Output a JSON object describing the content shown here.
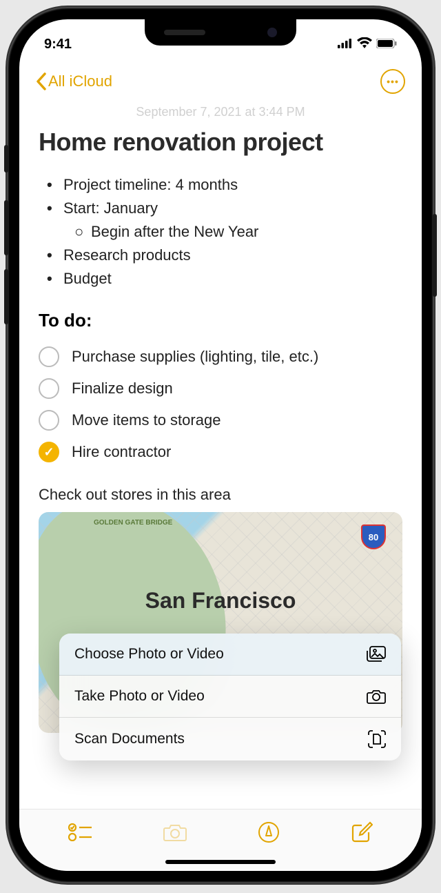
{
  "statusbar": {
    "time": "9:41"
  },
  "nav": {
    "back_label": "All iCloud"
  },
  "note": {
    "date": "September 7, 2021 at 3:44 PM",
    "title": "Home renovation project",
    "bullets": [
      "Project timeline: 4 months",
      "Start: January",
      "Research products",
      "Budget"
    ],
    "sub_bullet": "Begin after the New Year",
    "todo_heading": "To do:",
    "todos": [
      {
        "label": "Purchase supplies (lighting, tile, etc.)",
        "done": false
      },
      {
        "label": "Finalize design",
        "done": false
      },
      {
        "label": "Move items to storage",
        "done": false
      },
      {
        "label": "Hire contractor",
        "done": true
      }
    ],
    "area_label": "Check out stores in this area",
    "map": {
      "bridge": "GOLDEN GATE\nBRIDGE",
      "highway": "80",
      "city": "San Francisco",
      "sub": "San Francisco"
    }
  },
  "popup": {
    "items": [
      {
        "label": "Choose Photo or Video",
        "icon": "photo-library-icon"
      },
      {
        "label": "Take Photo or Video",
        "icon": "camera-icon"
      },
      {
        "label": "Scan Documents",
        "icon": "scan-icon"
      }
    ]
  }
}
